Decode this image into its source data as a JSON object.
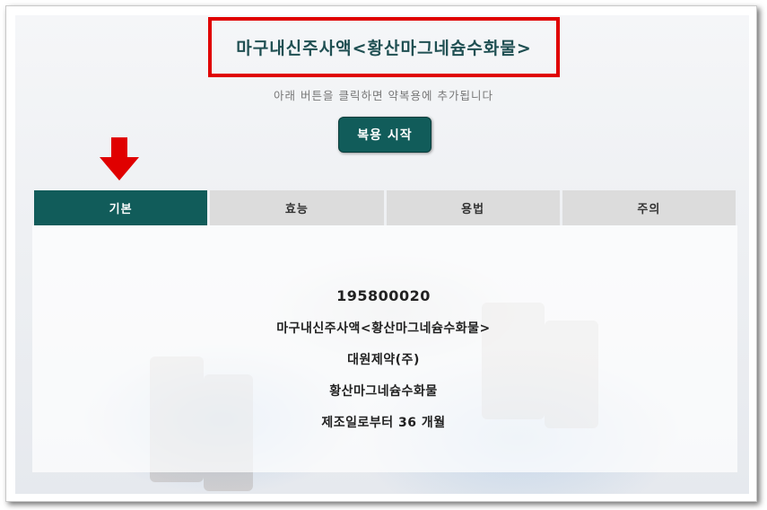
{
  "header": {
    "title": "마구내신주사액<황산마그네슘수화물>",
    "hint": "아래 버튼을 클릭하면 약복용에 추가됩니다",
    "start_button_label": "복용 시작"
  },
  "tabs": [
    {
      "label": "기본",
      "active": true
    },
    {
      "label": "효능",
      "active": false
    },
    {
      "label": "용법",
      "active": false
    },
    {
      "label": "주의",
      "active": false
    }
  ],
  "info": {
    "code": "195800020",
    "product_name": "마구내신주사액<황산마그네슘수화물>",
    "manufacturer": "대원제약(주)",
    "ingredient": "황산마그네슘수화물",
    "expiry": "제조일로부터 36 개월"
  },
  "colors": {
    "accent": "#115c5a",
    "highlight_border": "#e00000",
    "arrow": "#e00000"
  }
}
